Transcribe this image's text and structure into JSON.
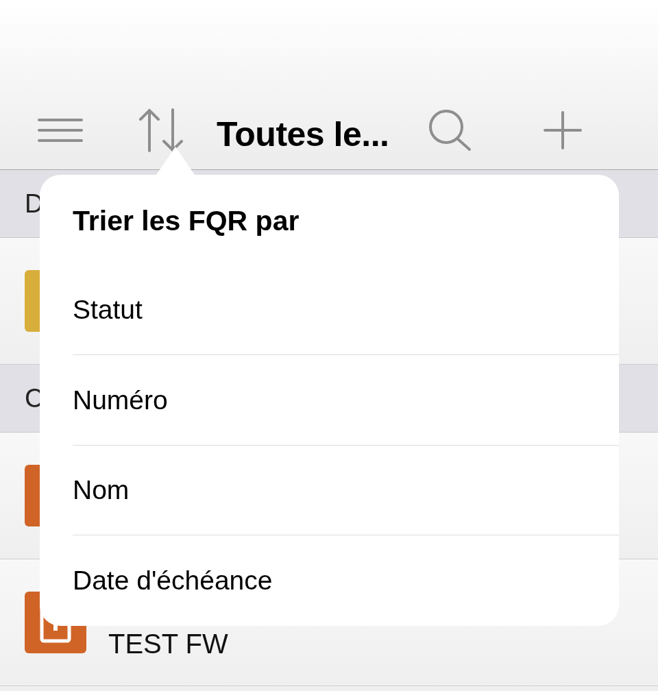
{
  "nav_bar": {
    "title": "Toutes le..."
  },
  "list": [
    {
      "kind": "section",
      "label": "D"
    },
    {
      "kind": "row",
      "color": "#d8ae3a"
    },
    {
      "kind": "section",
      "label": "C"
    },
    {
      "kind": "row",
      "color": "#d06427"
    },
    {
      "kind": "row",
      "color": "#d06427",
      "title": "TEST FW",
      "document": true
    }
  ],
  "sort_popover": {
    "title": "Trier les FQR par",
    "options": [
      "Statut",
      "Numéro",
      "Nom",
      "Date d'échéance"
    ]
  }
}
